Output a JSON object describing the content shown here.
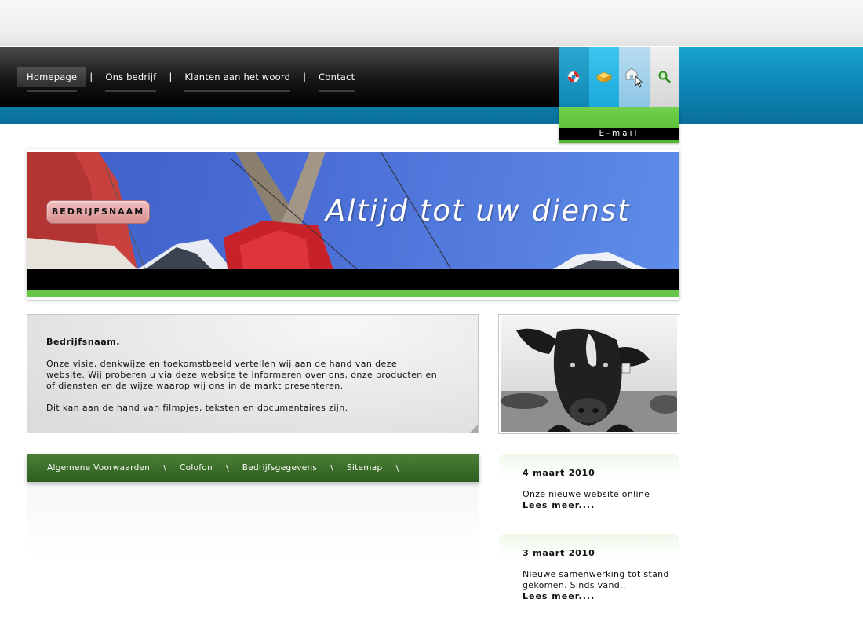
{
  "nav": {
    "items": [
      {
        "label": "Homepage"
      },
      {
        "label": "Ons bedrijf"
      },
      {
        "label": "Klanten aan het woord"
      },
      {
        "label": "Contact"
      }
    ],
    "separator": "|"
  },
  "iconbar": {
    "icons": [
      "lifebuoy-icon",
      "box-icon",
      "house-icon",
      "search-icon"
    ],
    "email_label": "E-mail"
  },
  "banner": {
    "brand": "BEDRIJFSNAAM",
    "tagline": "Altijd tot uw dienst"
  },
  "intro": {
    "title": "Bedrijfsnaam.",
    "paragraph1": "Onze visie, denkwijze en toekomstbeeld vertellen wij aan de hand van deze website. Wij proberen u via deze website te informeren over ons, onze producten en of diensten en de wijze waarop wij ons in de markt presenteren.",
    "paragraph2": "Dit kan aan de hand van filmpjes, teksten en documentaires zijn."
  },
  "footer": {
    "links": [
      "Algemene Voorwaarden",
      "Colofon",
      "Bedrijfsgegevens",
      "Sitemap"
    ],
    "separator": "\\"
  },
  "news": [
    {
      "date": "4 maart 2010",
      "text": "Onze nieuwe website online",
      "more": "Lees meer...."
    },
    {
      "date": "3 maart 2010",
      "text": "Nieuwe samenwerking tot stand gekomen. Sinds vand..",
      "more": "Lees meer...."
    }
  ],
  "colors": {
    "accent_blue": "#0b84b5",
    "accent_green": "#67c64a",
    "footer_green": "#3d6e2a",
    "nav_black": "#161616"
  }
}
